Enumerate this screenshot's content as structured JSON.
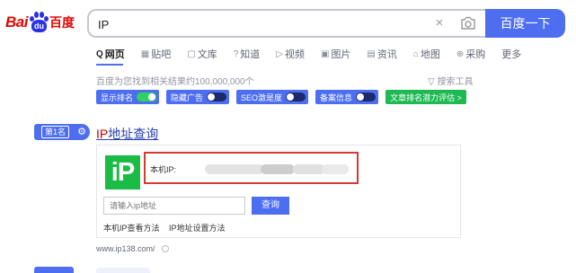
{
  "header": {
    "logo_text_left": "Bai",
    "logo_paw_text": "du",
    "logo_text_right": "百度"
  },
  "search": {
    "query": "IP",
    "placeholder": "",
    "button_label": "百度一下",
    "clear_symbol": "×"
  },
  "tabs": [
    {
      "label": "网页",
      "icon": "Q",
      "active": true
    },
    {
      "label": "贴吧",
      "icon": "▦",
      "active": false
    },
    {
      "label": "文库",
      "icon": "▢",
      "active": false
    },
    {
      "label": "知道",
      "icon": "?",
      "active": false
    },
    {
      "label": "视频",
      "icon": "▷",
      "active": false
    },
    {
      "label": "图片",
      "icon": "▣",
      "active": false
    },
    {
      "label": "资讯",
      "icon": "▤",
      "active": false
    },
    {
      "label": "地图",
      "icon": "⌂",
      "active": false
    },
    {
      "label": "采购",
      "icon": "⊕",
      "active": false
    },
    {
      "label": "更多",
      "icon": "",
      "active": false
    }
  ],
  "meta": {
    "result_count": "百度为您找到相关结果约100,000,000个",
    "search_tools": "搜索工具",
    "search_tools_icon": "▽"
  },
  "toggles": [
    {
      "label": "显示排名",
      "state": "on"
    },
    {
      "label": "隐藏广告",
      "state": "off"
    },
    {
      "label": "SEO激是度",
      "state": "off"
    },
    {
      "label": "备案信息",
      "state": "off"
    },
    {
      "label": "文章排名潜力评估 >",
      "state": "link"
    }
  ],
  "result1": {
    "rank_label": "第1名",
    "rank_icon": "⚙",
    "title_highlight": "IP",
    "title_rest": "地址查询",
    "logo_text": "iP",
    "ip_label": "本机IP:",
    "input_placeholder": "请输入ip地址",
    "query_button": "查询",
    "link1": "本机IP查看方法",
    "link2": "IP地址设置方法",
    "url": "www.ip138.com/"
  },
  "colors": {
    "accent": "#4e6ef2",
    "title_link": "#2440b3",
    "highlight_red": "#c00000",
    "ip_green": "#1bbc46",
    "box_red": "#d33a31",
    "toggle_on": "#2fd15f"
  }
}
